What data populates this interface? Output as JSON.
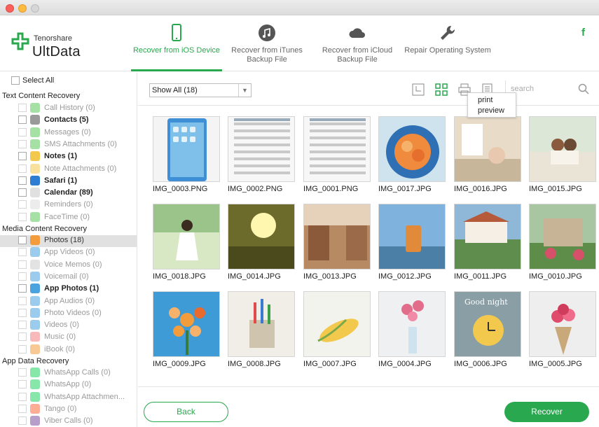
{
  "brand": {
    "small": "Tenorshare",
    "big": "UltData",
    "color": "#2aa84f"
  },
  "nav": [
    {
      "label": "Recover from iOS Device",
      "icon": "phone-icon",
      "active": true
    },
    {
      "label": "Recover from iTunes Backup File",
      "icon": "music-note-icon",
      "active": false
    },
    {
      "label": "Recover from iCloud Backup File",
      "icon": "cloud-icon",
      "active": false
    },
    {
      "label": "Repair Operating System",
      "icon": "wrench-icon",
      "active": false
    }
  ],
  "social": {
    "facebook": "f"
  },
  "sidebar": {
    "select_all": "Select All",
    "sections": [
      "Text Content Recovery",
      "Media Content Recovery",
      "App Data Recovery"
    ],
    "text_items": [
      {
        "label": "Call History (0)",
        "state": "off",
        "icon_color": "#5bc85b"
      },
      {
        "label": "Contacts (5)",
        "state": "on",
        "icon_color": "#9a9a9a"
      },
      {
        "label": "Messages (0)",
        "state": "off",
        "icon_color": "#5bc85b"
      },
      {
        "label": "SMS Attachments (0)",
        "state": "off",
        "icon_color": "#5bc85b"
      },
      {
        "label": "Notes (1)",
        "state": "on",
        "icon_color": "#f2c94c"
      },
      {
        "label": "Note Attachments (0)",
        "state": "off",
        "icon_color": "#f2c94c"
      },
      {
        "label": "Safari (1)",
        "state": "on",
        "icon_color": "#2d7dd2"
      },
      {
        "label": "Calendar (89)",
        "state": "on",
        "icon_color": "#e0e0e0"
      },
      {
        "label": "Reminders (0)",
        "state": "off",
        "icon_color": "#dddddd"
      },
      {
        "label": "FaceTime (0)",
        "state": "off",
        "icon_color": "#5bc85b"
      }
    ],
    "media_items": [
      {
        "label": "Photos (18)",
        "state": "sel",
        "icon_color": "#f39c3c"
      },
      {
        "label": "App Videos (0)",
        "state": "off",
        "icon_color": "#4aa3df"
      },
      {
        "label": "Voice Memos (0)",
        "state": "off",
        "icon_color": "#cccccc"
      },
      {
        "label": "Voicemail (0)",
        "state": "off",
        "icon_color": "#4aa3df"
      },
      {
        "label": "App Photos (1)",
        "state": "on",
        "icon_color": "#4aa3df"
      },
      {
        "label": "App Audios (0)",
        "state": "off",
        "icon_color": "#4aa3df"
      },
      {
        "label": "Photo Videos (0)",
        "state": "off",
        "icon_color": "#4aa3df"
      },
      {
        "label": "Videos (0)",
        "state": "off",
        "icon_color": "#4aa3df"
      },
      {
        "label": "Music (0)",
        "state": "off",
        "icon_color": "#f08080"
      },
      {
        "label": "iBook (0)",
        "state": "off",
        "icon_color": "#f39c3c"
      }
    ],
    "app_items": [
      {
        "label": "WhatsApp Calls (0)",
        "state": "off",
        "icon_color": "#25d366"
      },
      {
        "label": "WhatsApp (0)",
        "state": "off",
        "icon_color": "#25d366"
      },
      {
        "label": "WhatsApp Attachmen...",
        "state": "off",
        "icon_color": "#25d366"
      },
      {
        "label": "Tango (0)",
        "state": "off",
        "icon_color": "#ff6a3d"
      },
      {
        "label": "Viber Calls (0)",
        "state": "off",
        "icon_color": "#7b519d"
      }
    ]
  },
  "toolbar": {
    "filter_value": "Show All (18)",
    "search_placeholder": "search",
    "tooltip_line1": "print",
    "tooltip_line2": "preview"
  },
  "photos": [
    {
      "name": "IMG_0003.PNG",
      "kind": "phone"
    },
    {
      "name": "IMG_0002.PNG",
      "kind": "settings"
    },
    {
      "name": "IMG_0001.PNG",
      "kind": "settings"
    },
    {
      "name": "IMG_0017.JPG",
      "kind": "flowers-blue"
    },
    {
      "name": "IMG_0016.JPG",
      "kind": "room"
    },
    {
      "name": "IMG_0015.JPG",
      "kind": "couple"
    },
    {
      "name": "IMG_0018.JPG",
      "kind": "girl"
    },
    {
      "name": "IMG_0014.JPG",
      "kind": "sunset"
    },
    {
      "name": "IMG_0013.JPG",
      "kind": "street"
    },
    {
      "name": "IMG_0012.JPG",
      "kind": "cup"
    },
    {
      "name": "IMG_0011.JPG",
      "kind": "garden"
    },
    {
      "name": "IMG_0010.JPG",
      "kind": "house"
    },
    {
      "name": "IMG_0009.JPG",
      "kind": "oranges"
    },
    {
      "name": "IMG_0008.JPG",
      "kind": "pencils"
    },
    {
      "name": "IMG_0007.JPG",
      "kind": "corn"
    },
    {
      "name": "IMG_0004.JPG",
      "kind": "vase"
    },
    {
      "name": "IMG_0006.JPG",
      "kind": "clock",
      "overlay_text": "Good night"
    },
    {
      "name": "IMG_0005.JPG",
      "kind": "bouquet"
    }
  ],
  "footer": {
    "back_label": "Back",
    "recover_label": "Recover"
  }
}
